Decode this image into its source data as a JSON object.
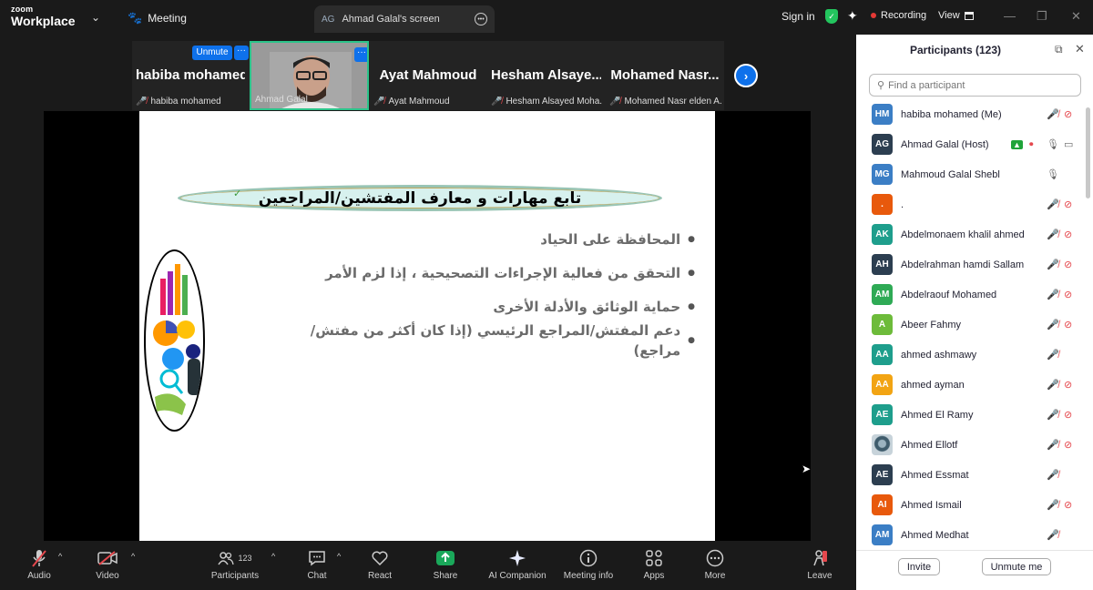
{
  "titlebar": {
    "logo_line1": "zoom",
    "logo_line2": "Workplace",
    "meeting_tab": "Meeting",
    "screen_tab_initials": "AG",
    "screen_tab_label": "Ahmad Galal's screen",
    "signin": "Sign in",
    "recording": "Recording",
    "view": "View"
  },
  "strip": {
    "tiles": [
      {
        "name": "habiba mohamed",
        "sub": "habiba mohamed",
        "unmute": "Unmute"
      },
      {
        "name": "",
        "sub": "Ahmad Galal"
      },
      {
        "name": "Ayat Mahmoud",
        "sub": "Ayat Mahmoud"
      },
      {
        "name": "Hesham Alsaye...",
        "sub": "Hesham Alsayed Moha..."
      },
      {
        "name": "Mohamed Nasr...",
        "sub": "Mohamed Nasr elden A..."
      }
    ]
  },
  "slide": {
    "title": "تابع مهارات و معارف المفتشين/المراجعين",
    "bullets": [
      "المحافظة على الحياد",
      "التحقق من فعالية الإجراءات التصحيحية ، إذا لزم الأمر",
      "حماية الوثائق والأدلة الأخرى",
      "دعم المفتش/المراجع الرئيسي (إذا كان أكثر من مفتش/مراجع)"
    ]
  },
  "toolbar": {
    "audio": "Audio",
    "video": "Video",
    "participants": "Participants",
    "participants_count": "123",
    "chat": "Chat",
    "react": "React",
    "share": "Share",
    "ai": "AI Companion",
    "info": "Meeting info",
    "apps": "Apps",
    "more": "More",
    "leave": "Leave"
  },
  "panel": {
    "title": "Participants (123)",
    "search_placeholder": "Find a participant",
    "invite": "Invite",
    "unmute_me": "Unmute me",
    "participants": [
      {
        "initials": "HM",
        "name": "habiba mohamed (Me)",
        "color": "#3b7ec5",
        "mic": "off",
        "cam": "off"
      },
      {
        "initials": "AG",
        "name": "Ahmad Galal (Host)",
        "color": "#2c3e50",
        "mic": "on",
        "cam": "on",
        "host": true
      },
      {
        "initials": "MG",
        "name": "Mahmoud Galal Shebl",
        "color": "#3b7ec5",
        "mic": "on",
        "cam": "none"
      },
      {
        "initials": ".",
        "name": ".",
        "color": "#e8590c",
        "mic": "off",
        "cam": "off"
      },
      {
        "initials": "AK",
        "name": "Abdelmonaem khalil ahmed",
        "color": "#1e9e8c",
        "mic": "off",
        "cam": "off"
      },
      {
        "initials": "AH",
        "name": "Abdelrahman hamdi Sallam",
        "color": "#2c3e50",
        "mic": "off",
        "cam": "off"
      },
      {
        "initials": "AM",
        "name": "Abdelraouf Mohamed",
        "color": "#2eaa55",
        "mic": "off",
        "cam": "off"
      },
      {
        "initials": "A",
        "name": "Abeer Fahmy",
        "color": "#6dbb3a",
        "mic": "off",
        "cam": "off"
      },
      {
        "initials": "AA",
        "name": "ahmed ashmawy",
        "color": "#1e9e8c",
        "mic": "off",
        "cam": "none"
      },
      {
        "initials": "AA",
        "name": "ahmed ayman",
        "color": "#f2a413",
        "mic": "off",
        "cam": "off"
      },
      {
        "initials": "AE",
        "name": "Ahmed El Ramy",
        "color": "#1e9e8c",
        "mic": "off",
        "cam": "off"
      },
      {
        "initials": "",
        "name": "Ahmed Ellotf",
        "color": "#5a7a8c",
        "mic": "off",
        "cam": "off",
        "photo": true
      },
      {
        "initials": "AE",
        "name": "Ahmed Essmat",
        "color": "#2c3e50",
        "mic": "off",
        "cam": "none"
      },
      {
        "initials": "AI",
        "name": "Ahmed Ismail",
        "color": "#e8590c",
        "mic": "off",
        "cam": "off"
      },
      {
        "initials": "AM",
        "name": "Ahmed Medhat",
        "color": "#3b7ec5",
        "mic": "off",
        "cam": "none"
      }
    ]
  }
}
